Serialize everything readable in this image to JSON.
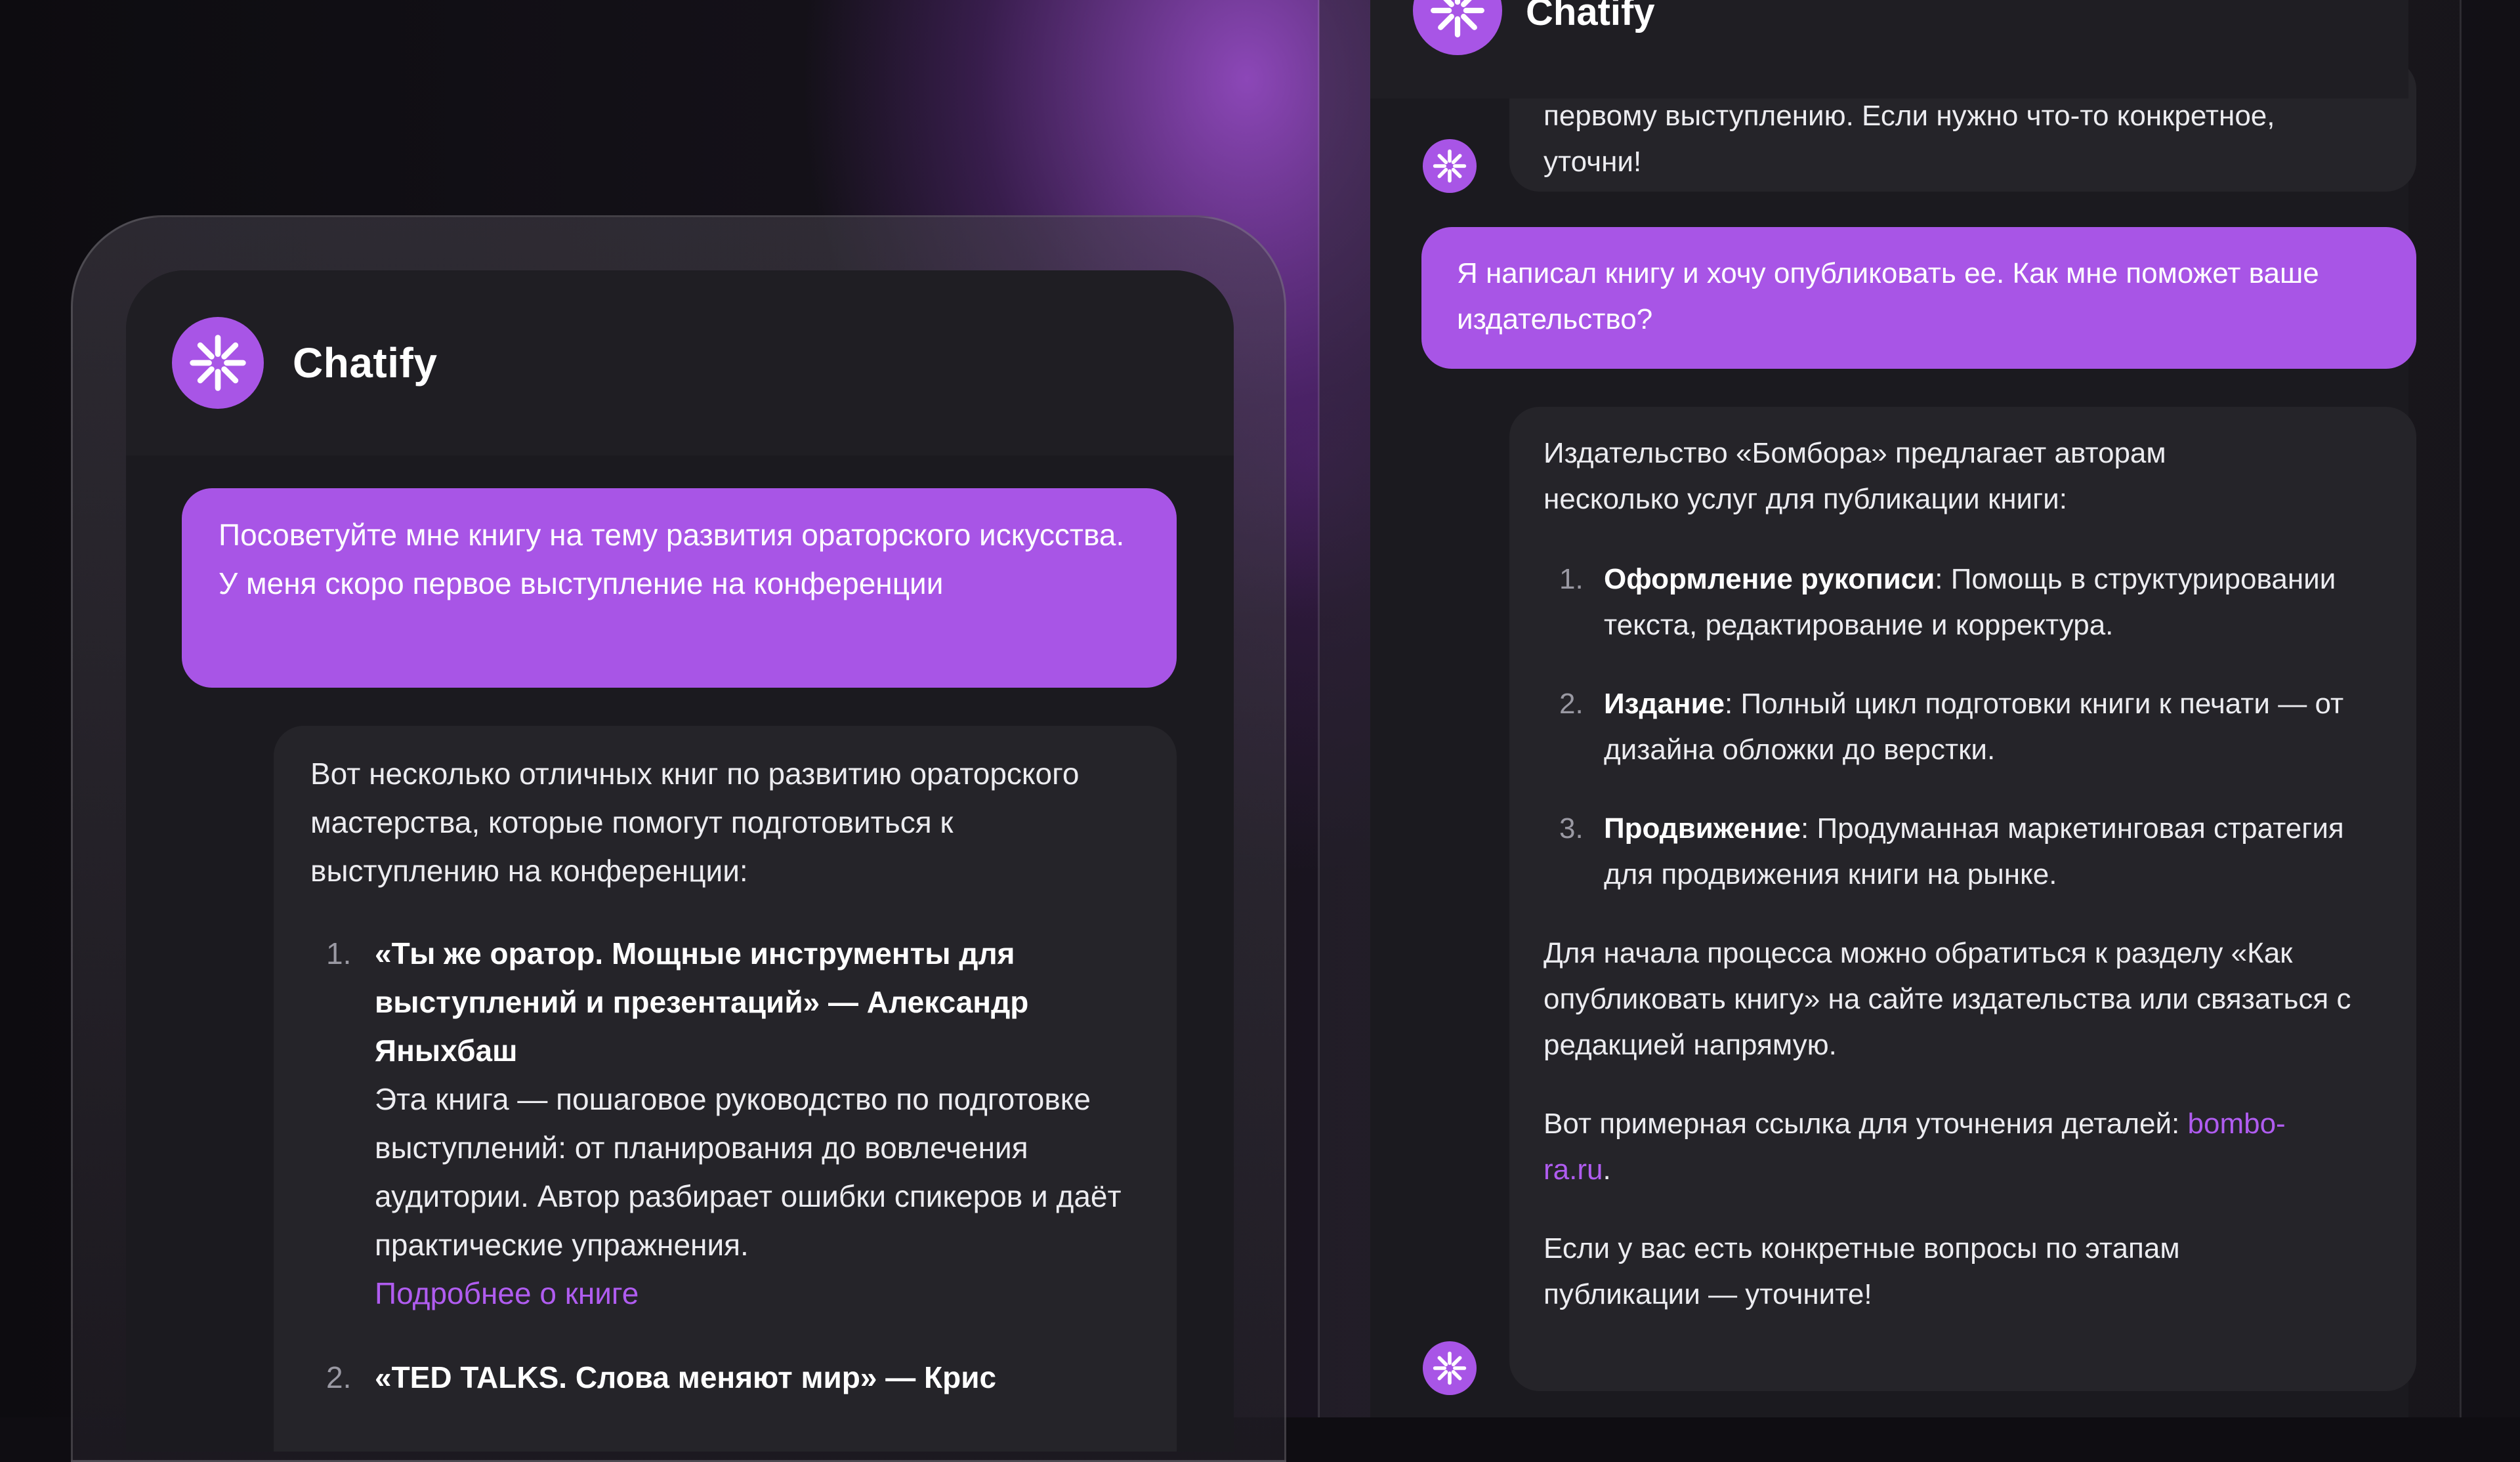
{
  "app": {
    "name": "Chatify"
  },
  "left_chat": {
    "user_message": "Посоветуйте мне книгу на тему развития ораторского искусства. У меня скоро первое выступление на конференции",
    "bot_intro": "Вот несколько отличных книг по развитию ораторского мастерства, которые помогут подготовиться к выступлению на конференции:",
    "books": [
      {
        "num": "1.",
        "title_line1": "«Ты же оратор. Мощные инструменты для",
        "title_line2": "выступлений и презентаций» — Александр",
        "title_line3": "Яныхбаш",
        "description": "Эта книга — пошаговое руководство по подготовке выступлений: от планирования до вовлечения аудитории. Автор разбирает ошибки спикеров и даёт практические упражнения.",
        "link": "Подробнее о книге"
      },
      {
        "num": "2.",
        "title_line1": "«TED TALKS. Слова меняют мир» — Крис"
      }
    ]
  },
  "right_chat": {
    "prev_bot_tail_line1": "первому выступлению. Если нужно что-то конкретное,",
    "prev_bot_tail_line2": "уточни!",
    "user_message": "Я написал книгу и хочу опубликовать ее. Как мне поможет ваше издательство?",
    "bot_intro": "Издательство «Бомбора» предлагает авторам несколько услуг для публикации книги:",
    "services": [
      {
        "num": "1.",
        "name": "Оформление рукописи",
        "text": ": Помощь в структурировании текста, редактирование и корректура."
      },
      {
        "num": "2.",
        "name": "Издание",
        "text": ": Полный цикл подготовки книги к печати — от дизайна обложки до верстки."
      },
      {
        "num": "3.",
        "name": "Продвижение",
        "text": ": Продуманная маркетинговая стратегия для продвижения книги на рынке."
      }
    ],
    "contact_text": "Для начала процесса можно обратиться к разделу «Как опубликовать книгу» на сайте издательства или связаться с редакцией напрямую.",
    "link_prefix": "Вот примерная ссылка для уточнения деталей: ",
    "link_line1": "bombo-",
    "link_line2": "ra.ru",
    "link_suffix": ".",
    "closing": "Если у вас есть конкретные вопросы по этапам публикации — уточните!"
  },
  "icons": {
    "logo": "sparkle-asterisk-icon"
  },
  "colors": {
    "accent": "#a855e6",
    "link": "#b05cf0",
    "bubble_bot": "#252429",
    "header": "#1f1e23"
  }
}
